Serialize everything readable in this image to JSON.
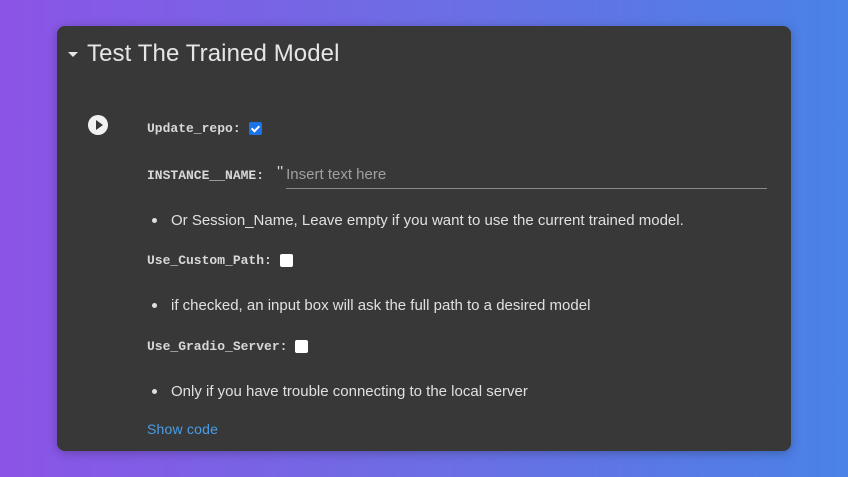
{
  "section": {
    "title": "Test The Trained Model"
  },
  "form": {
    "update_repo": {
      "label": "Update_repo:",
      "checked": true
    },
    "instance_name": {
      "label": "INSTANCE__NAME:",
      "quote": "''",
      "value": "",
      "placeholder": "Insert text here"
    },
    "note_instance": "Or Session_Name, Leave empty if you want to use the current trained model.",
    "use_custom_path": {
      "label": "Use_Custom_Path:",
      "checked": false
    },
    "note_custom_path": "if checked, an input box will ask the full path to a desired model",
    "use_gradio_server": {
      "label": "Use_Gradio_Server:",
      "checked": false
    },
    "note_gradio": "Only if you have trouble connecting to the local server"
  },
  "footer": {
    "show_code": "Show code"
  },
  "colors": {
    "panel_bg": "#383838",
    "accent_blue": "#1a73e8",
    "link_blue": "#4a9ee8"
  },
  "icons": {
    "collapse": "caret-down-icon",
    "run": "play-icon",
    "check": "checkmark-icon"
  }
}
